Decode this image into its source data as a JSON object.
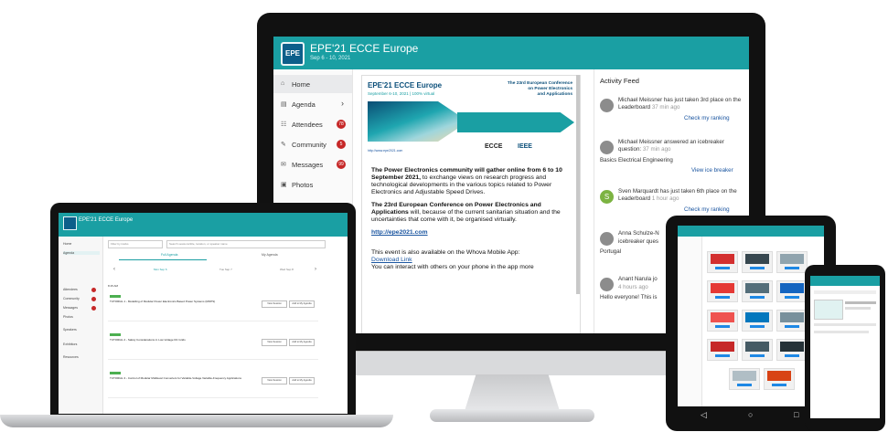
{
  "monitor": {
    "app": {
      "logo": "EPE",
      "title": "EPE'21 ECCE Europe",
      "dates": "Sep 6 - 10, 2021"
    },
    "nav": [
      {
        "label": "Home",
        "icon": "home-icon",
        "glyph": "⌂",
        "badge": ""
      },
      {
        "label": "Agenda",
        "icon": "calendar-icon",
        "glyph": "▤",
        "badge": ""
      },
      {
        "label": "Attendees",
        "icon": "people-icon",
        "glyph": "☷",
        "badge": "78"
      },
      {
        "label": "Community",
        "icon": "chat-icon",
        "glyph": "✎",
        "badge": "5"
      },
      {
        "label": "Messages",
        "icon": "envelope-icon",
        "glyph": "✉",
        "badge": "99"
      },
      {
        "label": "Photos",
        "icon": "camera-icon",
        "glyph": "▣",
        "badge": ""
      }
    ],
    "banner": {
      "title": "EPE'21 ECCE Europe",
      "subtitle": "September 6-10, 2021 | 100% virtual",
      "right_line1": "The 23rd European Conference",
      "right_line2": "on Power Electronics",
      "right_line3": "and Applications",
      "url": "http://www.epe2021.com",
      "logo_ecce": "ECCE",
      "logo_ieee": "IEEE"
    },
    "content": {
      "p1_bold": "The Power Electronics community will gather online from 6 to 10 September 2021,",
      "p1_rest": " to exchange views on research progress and technological developments in the various topics related to Power Electronics and Adjustable Speed Drives.",
      "p2_bold": "The 23rd European Conference on Power Electronics and Applications",
      "p2_rest": " will, because of the current sanitarian situation and the uncertainties that come with it, be organised virtually.",
      "link": "http://epe2021.com",
      "p3": "This event is also available on the Whova Mobile App:",
      "download": "Download Link",
      "p4": "You can interact with others on your phone in the app more"
    },
    "feed": {
      "title": "Activity Feed",
      "items": [
        {
          "text": "Michael Meissner has just taken 3rd place on the Leaderboard",
          "time": "37 min ago",
          "detail": "",
          "link": "Check my ranking"
        },
        {
          "text": "Michael Meissner answered an icebreaker question:",
          "time": "37 min ago",
          "detail": "Basics Electrical Engineering",
          "link": "View ice breaker"
        },
        {
          "text": "Sven Marquardt has just taken 6th place on the Leaderboard",
          "time": "1 hour ago",
          "detail": "",
          "link": "Check my ranking"
        },
        {
          "text": "Anna Schulze-N",
          "time": "",
          "detail": "icebreaker ques",
          "link": "Portugal"
        },
        {
          "text": "Anant Narula jo",
          "time": "4 hours ago",
          "detail": "Hello everyone! This is",
          "link": ""
        }
      ],
      "avatar_s": "S"
    }
  },
  "laptop": {
    "title": "EPE'21 ECCE Europe",
    "nav": [
      "Home",
      "Agenda",
      "Attendees",
      "Community",
      "Messages",
      "Photos",
      "Speakers",
      "Exhibitors",
      "Resources"
    ],
    "filter_placeholder": "Filter by tracks",
    "search_placeholder": "Search sessions/title, location, or speaker name",
    "tabs": [
      "Full Agenda",
      "My Agenda"
    ],
    "days": [
      "Mon Sep 6",
      "Tue Sep 7",
      "Wed Sep 8"
    ],
    "time_label": "8:15 AM",
    "sessions": [
      "TUTORIAL 1 - Modelling of Modular Power Electronics Based Power Systems (MOPS)",
      "TUTORIAL 2 - Safety Considerations in Low Voltage DC Grids",
      "TUTORIAL 3 - Control of Modular Multilevel Converters for Variable-Voltage Variable-Frequency Applications"
    ],
    "btn_view": "View Session",
    "btn_add": "Add to My Agenda"
  },
  "tablet": {
    "nav_back": "◁",
    "nav_home": "○",
    "nav_recent": "□"
  },
  "colors": {
    "accent": "#1a9fa3",
    "badge": "#c62828",
    "link": "#1a55a0"
  }
}
